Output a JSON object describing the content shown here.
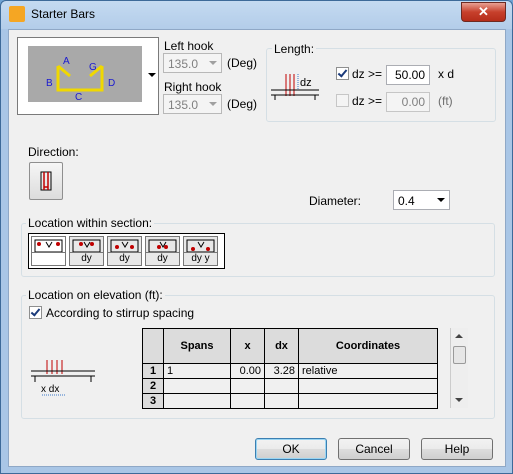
{
  "window": {
    "title": "Starter Bars",
    "close_label": "✕"
  },
  "hooks": {
    "preview_labels": [
      "A",
      "G",
      "B",
      "D",
      "C"
    ],
    "left_label": "Left hook",
    "left_value": "135.0",
    "left_unit": "(Deg)",
    "right_label": "Right hook",
    "right_value": "135.0",
    "right_unit": "(Deg)"
  },
  "length": {
    "group_label": "Length:",
    "diagram_label": "dz",
    "row1": {
      "checked": true,
      "label": "dz >=",
      "value": "50.00",
      "unit": "x d"
    },
    "row2": {
      "checked": false,
      "label": "dz >=",
      "value": "0.00",
      "unit": "(ft)"
    }
  },
  "direction": {
    "label": "Direction:"
  },
  "diameter": {
    "label": "Diameter:",
    "value": "0.4"
  },
  "location_section": {
    "label": "Location within section:",
    "buttons": [
      "",
      "dy",
      "dy",
      "dy",
      "dy y"
    ]
  },
  "elevation": {
    "group_label": "Location on elevation (ft):",
    "checkbox_label": "According to stirrup spacing",
    "checked": true,
    "diagram_label": "x  dx",
    "table": {
      "headers": [
        "Spans",
        "x",
        "dx",
        "Coordinates"
      ],
      "rows": [
        {
          "num": "1",
          "spans": "1",
          "x": "0.00",
          "dx": "3.28",
          "coords": "relative"
        },
        {
          "num": "2",
          "spans": "",
          "x": "",
          "dx": "",
          "coords": ""
        },
        {
          "num": "3",
          "spans": "",
          "x": "",
          "dx": "",
          "coords": ""
        }
      ]
    }
  },
  "buttons": {
    "ok": "OK",
    "cancel": "Cancel",
    "help": "Help"
  }
}
